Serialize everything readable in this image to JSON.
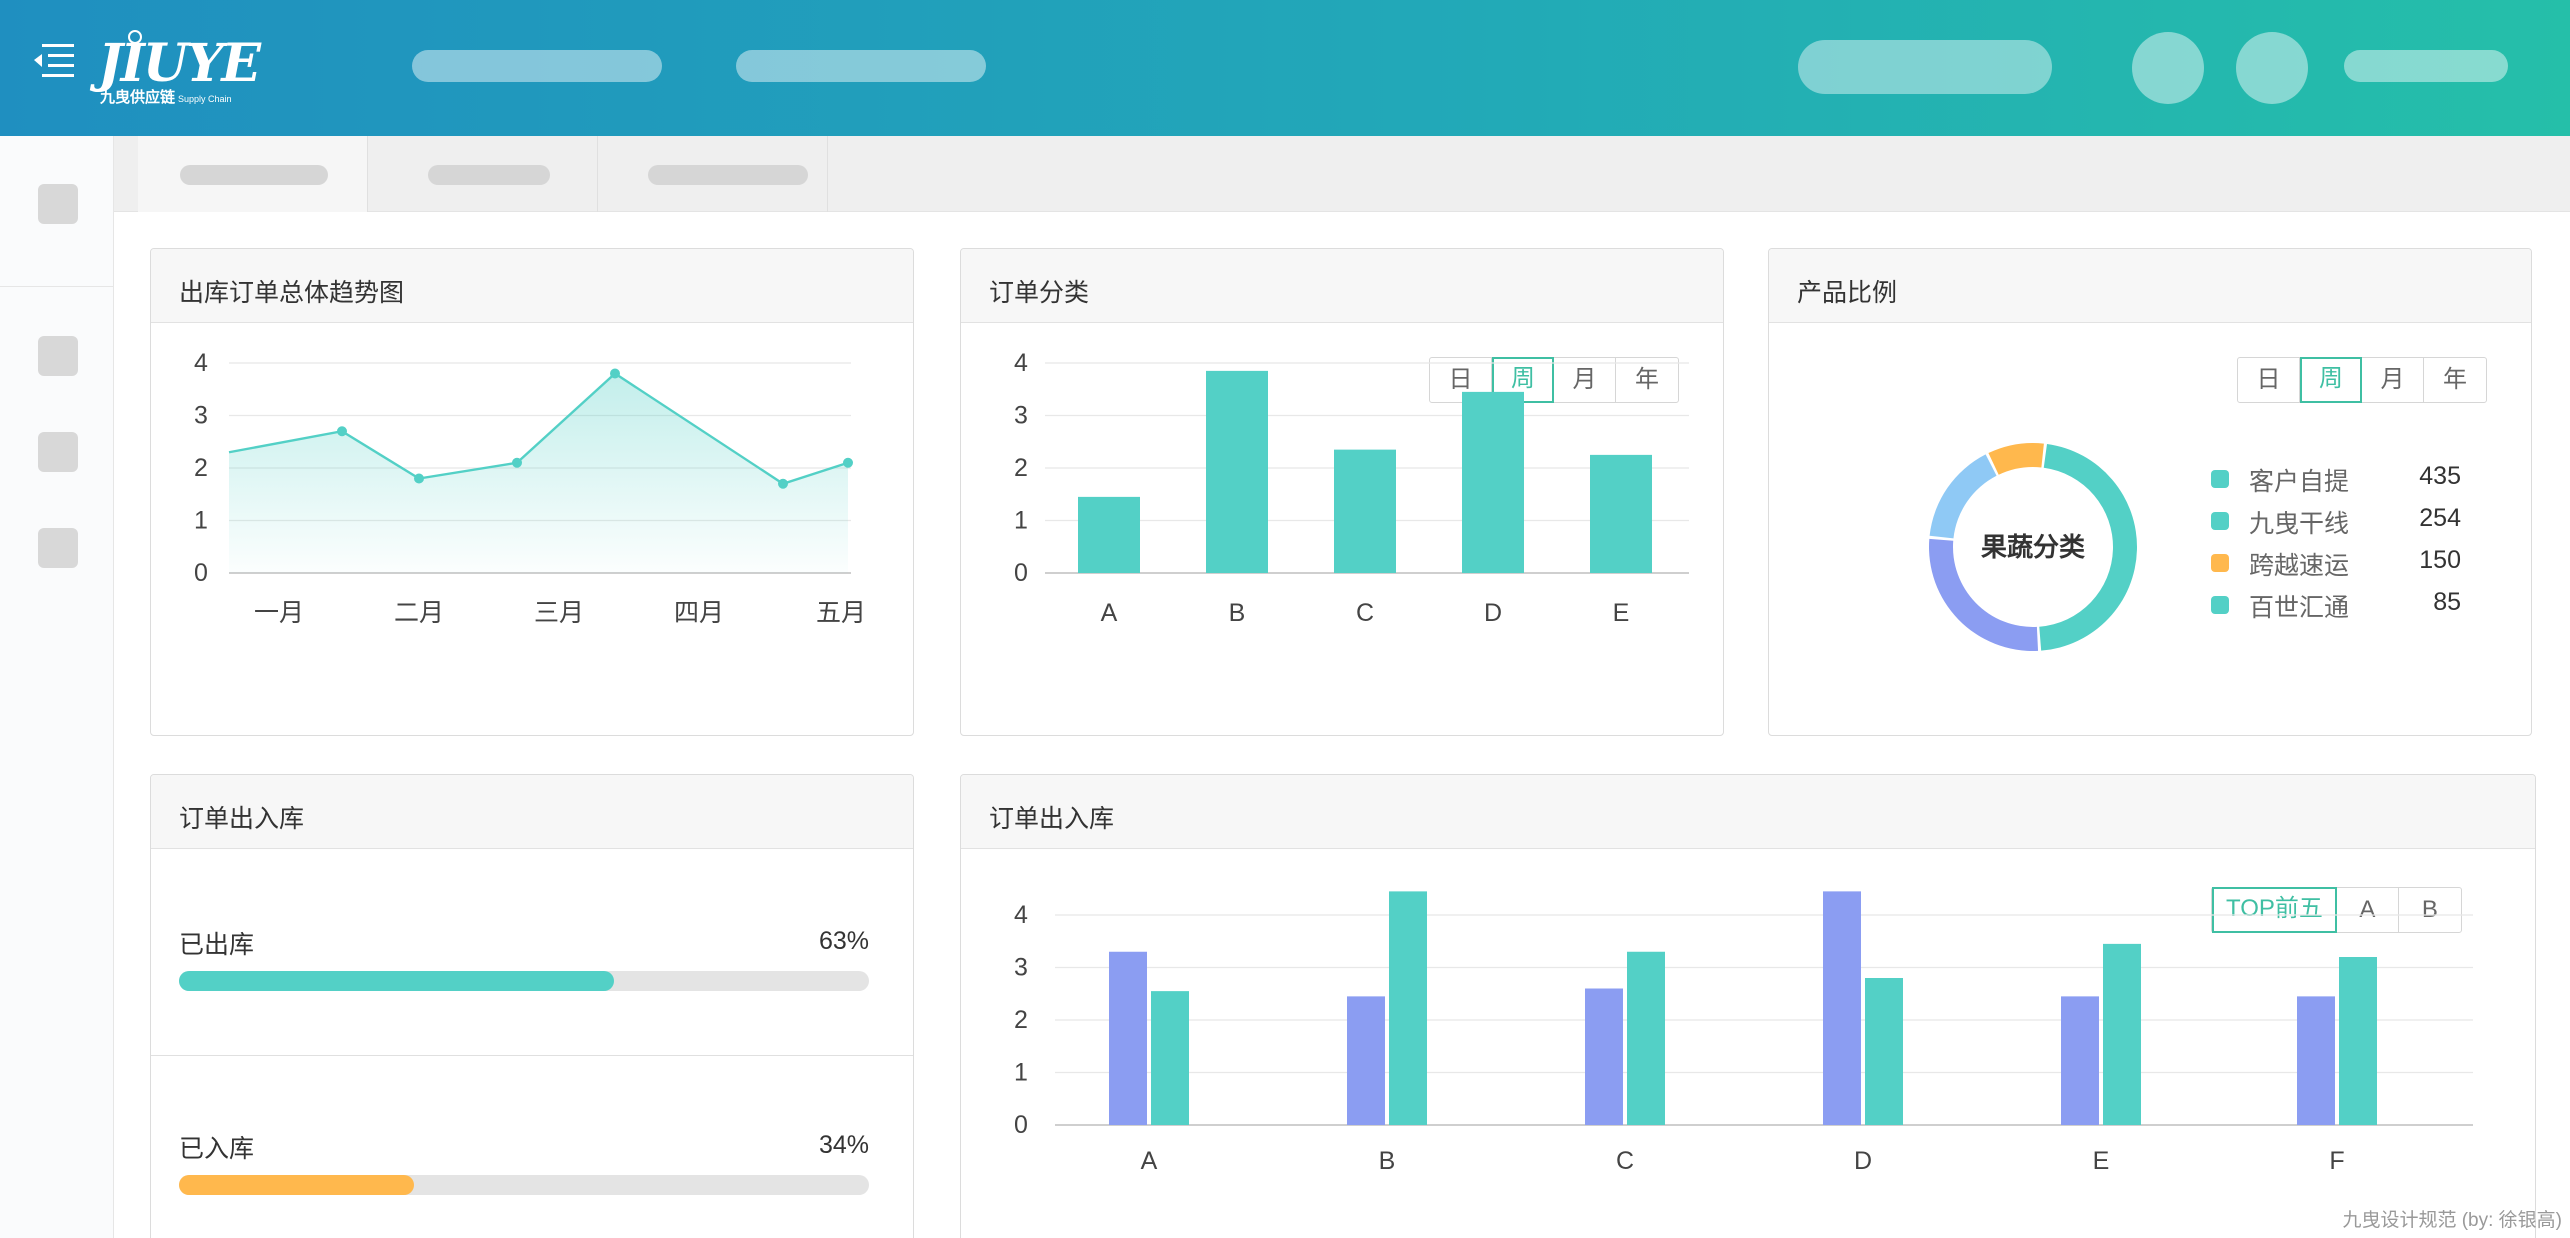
{
  "header": {
    "logo_text": "JIUYE",
    "logo_subtitle": "九曳供应链",
    "logo_subtitle_en": "Supply Chain"
  },
  "tabs": [
    {},
    {},
    {}
  ],
  "colors": {
    "teal": "#53d0c6",
    "blue": "#8b9df2",
    "light_blue": "#8fc9f5",
    "orange": "#ffb84d",
    "accent": "#3fbfa3"
  },
  "cards": {
    "trend": {
      "title": "出库订单总体趋势图"
    },
    "category": {
      "title": "订单分类",
      "period_options": [
        "日",
        "周",
        "月",
        "年"
      ],
      "period_selected": "周"
    },
    "ratio": {
      "title": "产品比例",
      "period_options": [
        "日",
        "周",
        "月",
        "年"
      ],
      "period_selected": "周",
      "center_label": "果蔬分类",
      "legend": [
        {
          "label": "客户自提",
          "value": "435",
          "color": "#53d0c6"
        },
        {
          "label": "九曳干线",
          "value": "254",
          "color": "#53d0c6"
        },
        {
          "label": "跨越速运",
          "value": "150",
          "color": "#ffb84d"
        },
        {
          "label": "百世汇通",
          "value": "85",
          "color": "#53d0c6"
        }
      ]
    },
    "progress": {
      "title": "订单出入库",
      "items": [
        {
          "label": "已出库",
          "percent_text": "63%",
          "value": 0.63,
          "color": "#53d0c6"
        },
        {
          "label": "已入库",
          "percent_text": "34%",
          "value": 0.34,
          "color": "#ffb84d"
        }
      ]
    },
    "inout": {
      "title": "订单出入库",
      "filter_options": [
        "TOP前五",
        "A",
        "B"
      ],
      "filter_selected": "TOP前五"
    }
  },
  "chart_data": [
    {
      "type": "area",
      "x": [
        "一月",
        "二月",
        "三月",
        "四月",
        "五月"
      ],
      "series": [
        {
          "values": [
            2.3,
            2.7,
            1.8,
            2.1,
            3.8,
            1.7,
            2.1
          ],
          "x_positions": [
            0,
            0.45,
            1.0,
            1.7,
            2.4,
            3.6,
            4.1
          ]
        }
      ],
      "yticks": [
        0,
        1,
        2,
        3,
        4
      ],
      "ylim": [
        0,
        4
      ],
      "grid": true
    },
    {
      "type": "bar",
      "categories": [
        "A",
        "B",
        "C",
        "D",
        "E"
      ],
      "values": [
        1.45,
        3.85,
        2.35,
        3.45,
        2.25
      ],
      "yticks": [
        0,
        1,
        2,
        3,
        4
      ],
      "ylim": [
        0,
        4
      ],
      "grid": true
    },
    {
      "type": "pie",
      "center_label": "果蔬分类",
      "labels": [
        "客户自提",
        "九曳干线",
        "跨越速运",
        "百世汇通"
      ],
      "values": [
        435,
        254,
        150,
        85
      ]
    },
    {
      "type": "bar",
      "categories": [
        "A",
        "B",
        "C",
        "D",
        "E",
        "F"
      ],
      "series": [
        {
          "values": [
            3.3,
            2.45,
            2.6,
            4.45,
            2.45,
            2.45
          ]
        },
        {
          "values": [
            2.55,
            4.45,
            3.3,
            2.8,
            3.45,
            3.2
          ]
        }
      ],
      "yticks": [
        0,
        1,
        2,
        3,
        4
      ],
      "ylim": [
        0,
        4
      ],
      "grid": true
    }
  ],
  "footer_note": "九曳设计规范 (by: 徐银高)"
}
